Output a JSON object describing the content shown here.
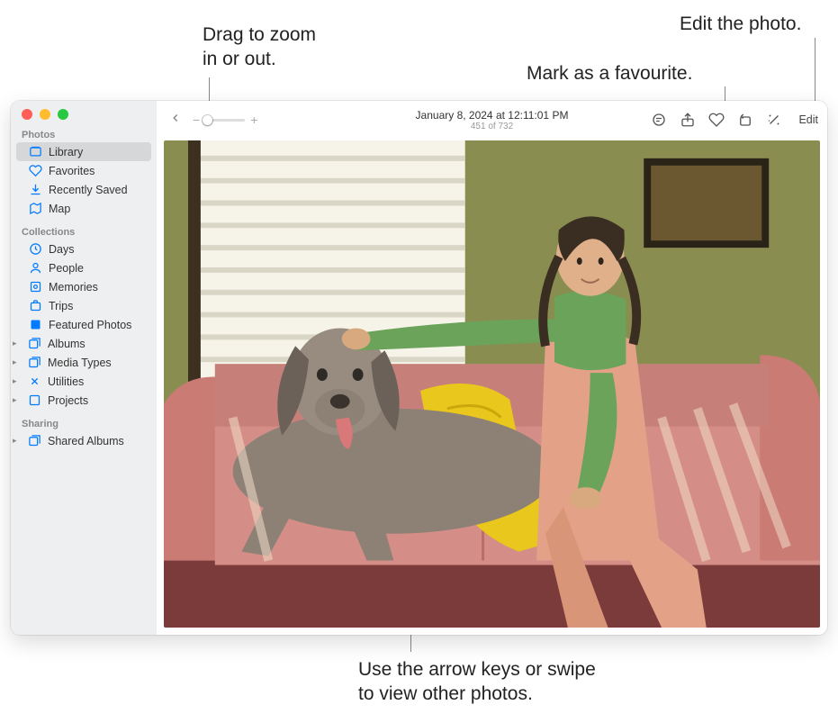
{
  "callouts": {
    "zoom": "Drag to zoom\nin or out.",
    "favorite": "Mark as a favourite.",
    "edit": "Edit the photo.",
    "arrows": "Use the arrow keys or swipe\nto view other photos."
  },
  "sidebar": {
    "sections": {
      "photos": "Photos",
      "collections": "Collections",
      "sharing": "Sharing"
    },
    "items": {
      "library": "Library",
      "favorites": "Favorites",
      "recently_saved": "Recently Saved",
      "map": "Map",
      "days": "Days",
      "people": "People",
      "memories": "Memories",
      "trips": "Trips",
      "featured": "Featured Photos",
      "albums": "Albums",
      "media_types": "Media Types",
      "utilities": "Utilities",
      "projects": "Projects",
      "shared_albums": "Shared Albums"
    }
  },
  "toolbar": {
    "date": "January 8, 2024 at 12:11:01 PM",
    "count": "451 of 732",
    "edit_label": "Edit",
    "zoom_minus": "−",
    "zoom_plus": "+"
  }
}
